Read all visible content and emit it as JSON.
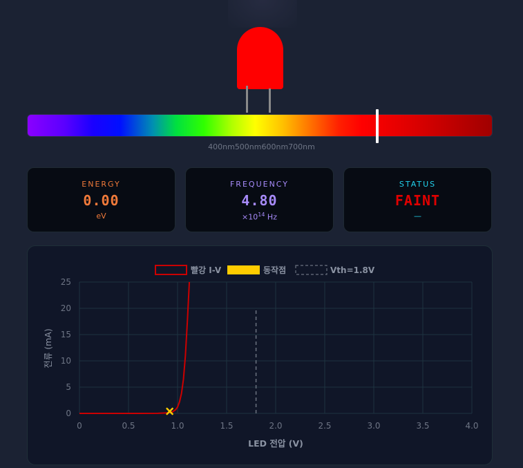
{
  "spectrum": {
    "labels": [
      "400nm",
      "500nm",
      "600nm",
      "700nm"
    ]
  },
  "cards": {
    "energy": {
      "title": "ENERGY",
      "value": "0.00",
      "unit": "eV",
      "color": "#f07a3a"
    },
    "frequency": {
      "title": "FREQUENCY",
      "value": "4.80",
      "unit_prefix": "×10",
      "unit_exp": "14",
      "unit_suffix": " Hz",
      "color": "#a78bfa"
    },
    "status": {
      "title": "STATUS",
      "value": "FAINT",
      "unit": "—",
      "color": "#e00000",
      "title_color": "#22d3ee"
    }
  },
  "led": {
    "color": "#ff0000"
  },
  "chart_data": {
    "type": "line",
    "xlabel": "LED 전압 (V)",
    "ylabel": "전류 (mA)",
    "xlim": [
      0,
      4.0
    ],
    "ylim": [
      0,
      25
    ],
    "x_ticks": [
      "0",
      "0.5",
      "1.0",
      "1.5",
      "2.0",
      "2.5",
      "3.0",
      "3.5",
      "4.0"
    ],
    "y_ticks": [
      "0",
      "5",
      "10",
      "15",
      "20",
      "25"
    ],
    "grid": true,
    "legend_position": "top",
    "legend": [
      "빨강 I-V",
      "동작점",
      "Vth=1.8V"
    ],
    "series": [
      {
        "name": "빨강 I-V",
        "color": "#cc0000",
        "x": [
          0,
          0.2,
          0.4,
          0.6,
          0.8,
          0.9,
          0.95,
          0.98,
          1.0,
          1.02,
          1.04,
          1.06,
          1.08,
          1.1,
          1.12
        ],
        "y": [
          0,
          0,
          0,
          0,
          0.02,
          0.1,
          0.3,
          0.7,
          1.2,
          2.2,
          3.8,
          6.5,
          11.0,
          17.5,
          25.0
        ]
      },
      {
        "name": "동작점",
        "color": "#ffcc00",
        "x": [
          0.92
        ],
        "y": [
          0
        ]
      },
      {
        "name": "Vth=1.8V",
        "color": "#6b7280",
        "x": [
          1.8,
          1.8
        ],
        "y": [
          0,
          20
        ]
      }
    ]
  }
}
